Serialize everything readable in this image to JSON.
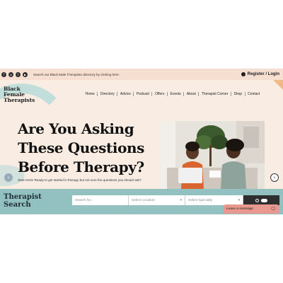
{
  "topbar": {
    "social_icons": [
      "facebook-icon",
      "instagram-icon",
      "twitter-icon",
      "youtube-icon"
    ],
    "message": "Search our Black Male Therapists directory by clicking here.",
    "register_login": "Register / Login"
  },
  "header": {
    "logo_line1": "Black",
    "logo_line2": "Female",
    "logo_line3": "Therapists",
    "nav": [
      "Home",
      "Directory",
      "Advice",
      "Podcast",
      "Offers",
      "Events",
      "About",
      "Therapist Corner",
      "Shop",
      "Contact"
    ]
  },
  "hero": {
    "headline_line1": "Are You Asking",
    "headline_line2": "These Questions",
    "headline_line3": "Before Therapy?",
    "subtext": "Start Here! Ready to get started in therapy but not sure the questions you should ask?"
  },
  "search": {
    "title_line1": "Therapist",
    "title_line2": "Search",
    "placeholder": "Search for...",
    "location": "Select Location",
    "specialty": "Select Specialty"
  },
  "chat": {
    "label": "Leave a message"
  },
  "colors": {
    "topbar": "#f6ded0",
    "hero_bg": "#f9ece2",
    "search_band": "#93c1c2",
    "chat": "#e9988f",
    "accent": "#f0b985"
  }
}
